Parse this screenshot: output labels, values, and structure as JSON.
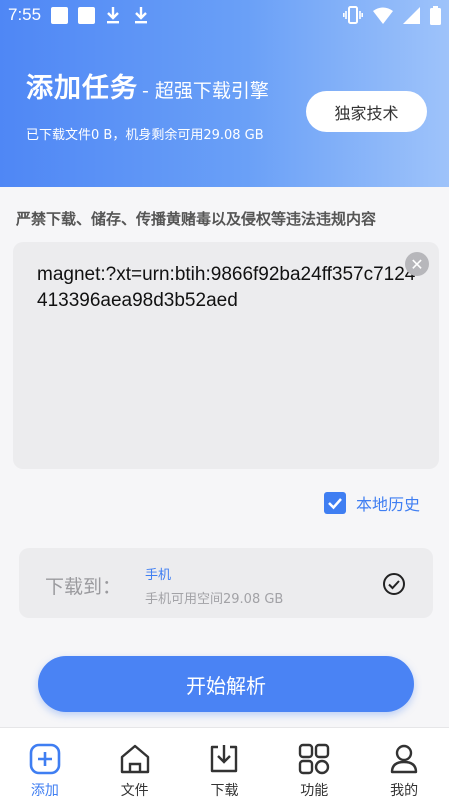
{
  "status_bar": {
    "time": "7:55",
    "icons": [
      "notification-square",
      "notification-square",
      "download-arrow",
      "download-arrow",
      "vibrate",
      "wifi",
      "signal",
      "battery"
    ]
  },
  "header": {
    "title": "添加任务",
    "subtitle": "- 超强下载引擎",
    "info": "已下载文件0 B，机身剩余可用29.08 GB",
    "exclusive_button": "独家技术"
  },
  "warning": "严禁下载、储存、传播黄赌毒以及侵权等违法违规内容",
  "magnet_input": {
    "value": "magnet:?xt=urn:btih:9866f92ba24ff357c7124413396aea98d3b52aed",
    "clear_icon": "clear-circle-icon"
  },
  "history": {
    "checked": true,
    "label": "本地历史"
  },
  "save_location": {
    "label": "下载到：",
    "device": "手机",
    "space": "手机可用空间29.08 GB"
  },
  "start_button": "开始解析",
  "tabs": [
    {
      "label": "添加",
      "icon": "add-icon",
      "active": true
    },
    {
      "label": "文件",
      "icon": "home-icon",
      "active": false
    },
    {
      "label": "下载",
      "icon": "download-icon",
      "active": false
    },
    {
      "label": "功能",
      "icon": "grid-icon",
      "active": false
    },
    {
      "label": "我的",
      "icon": "user-icon",
      "active": false
    }
  ],
  "colors": {
    "accent": "#3f7ef2",
    "header_gradient_start": "#4f87f5",
    "header_gradient_end": "#9ec3fa"
  }
}
